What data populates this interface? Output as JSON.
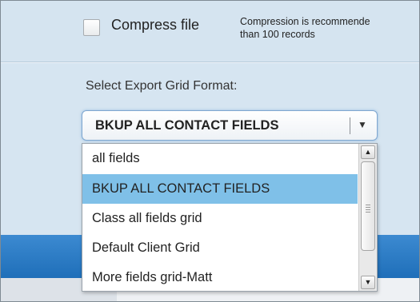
{
  "compress": {
    "label": "Compress file",
    "note_line1": "Compression is recommende",
    "note_line2": "than 100 records"
  },
  "export_format": {
    "label": "Select Export Grid Format:",
    "selected_value": "BKUP ALL CONTACT FIELDS",
    "arrow_icon": "▼",
    "options": [
      {
        "label": "all fields",
        "selected": false
      },
      {
        "label": "BKUP ALL CONTACT FIELDS",
        "selected": true
      },
      {
        "label": "Class all fields grid",
        "selected": false
      },
      {
        "label": "Default Client Grid",
        "selected": false
      },
      {
        "label": "More fields grid-Matt",
        "selected": false
      }
    ]
  },
  "scrollbar": {
    "up_icon": "▲",
    "down_icon": "▼"
  },
  "colors": {
    "panel_background": "#d6e5f1",
    "highlight": "#7fc0e8",
    "band": "#2b7cc6"
  }
}
